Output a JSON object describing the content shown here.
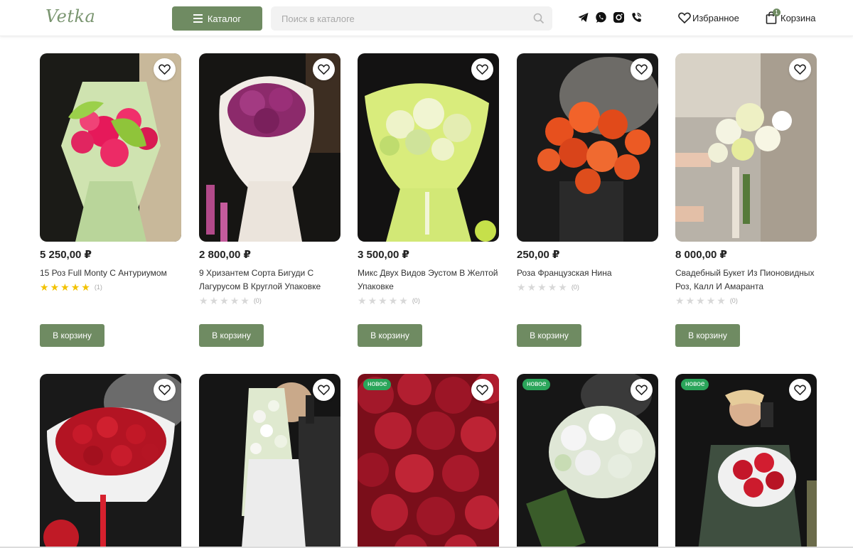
{
  "header": {
    "logo": "Vetka",
    "catalog_label": "Каталог",
    "search_placeholder": "Поиск в каталоге",
    "favorites_label": "Избранное",
    "cart_label": "Корзина",
    "cart_count": "1",
    "socials": [
      "telegram-icon",
      "whatsapp-icon",
      "instagram-icon",
      "viber-icon"
    ]
  },
  "colors": {
    "accent": "#6f8b62",
    "new_badge": "#2aa55a",
    "star": "#f2c200"
  },
  "products": [
    {
      "price": "5 250,00 ₽",
      "title": "15 Роз Full Monty С Антуриумом",
      "rating": 5,
      "reviews": "(1)",
      "button": "В корзину"
    },
    {
      "price": "2 800,00 ₽",
      "title": "9 Хризантем Сорта Бигуди С Лагурусом В Круглой Упаковке",
      "rating": 0,
      "reviews": "(0)",
      "button": "В корзину"
    },
    {
      "price": "3 500,00 ₽",
      "title": "Микс Двух Видов Эустом В Желтой Упаковке",
      "rating": 0,
      "reviews": "(0)",
      "button": "В корзину"
    },
    {
      "price": "250,00 ₽",
      "title": "Роза Французская Нина",
      "rating": 0,
      "reviews": "(0)",
      "button": "В корзину"
    },
    {
      "price": "8 000,00 ₽",
      "title": "Свадебный Букет Из Пионовидных Роз, Калл И Амаранта",
      "rating": 0,
      "reviews": "(0)",
      "button": "В корзину"
    }
  ],
  "products_row2": [
    {
      "badge": ""
    },
    {
      "badge": ""
    },
    {
      "badge": "новое"
    },
    {
      "badge": "новое"
    },
    {
      "badge": "новое"
    }
  ]
}
